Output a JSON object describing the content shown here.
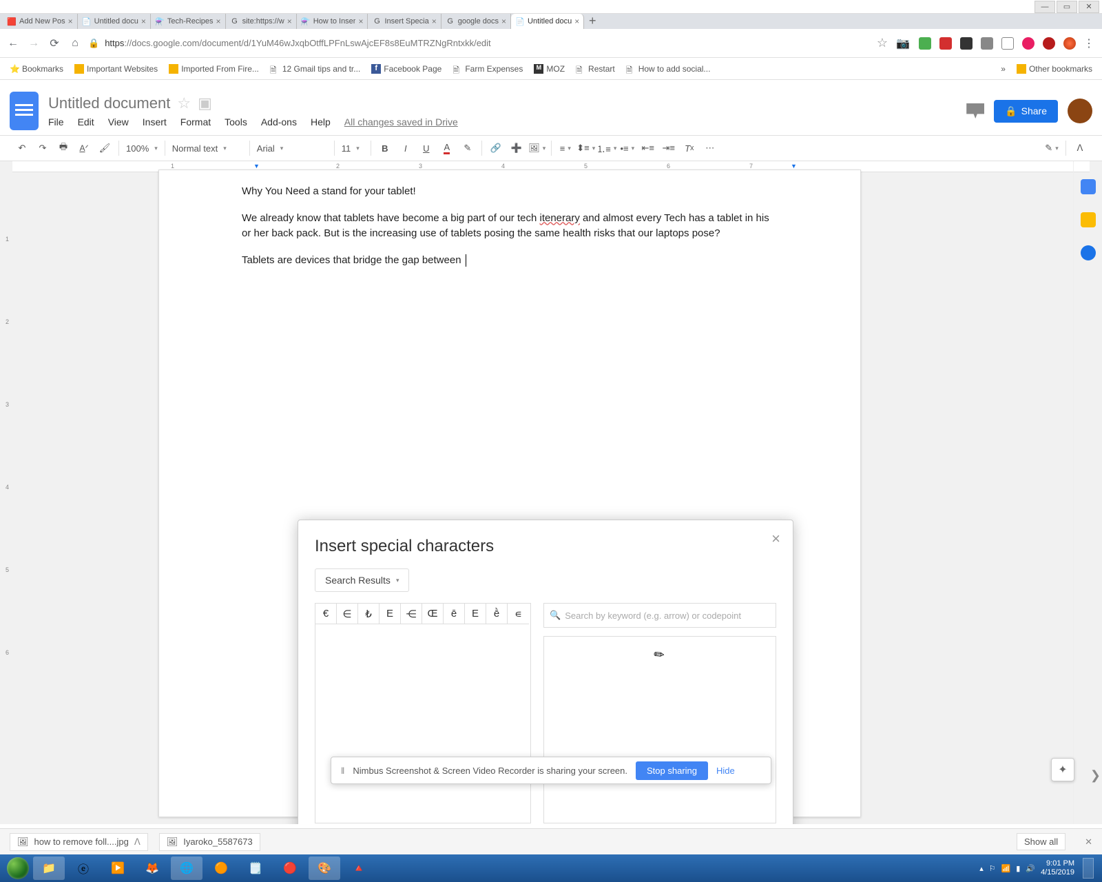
{
  "window_buttons": {
    "min": "—",
    "max": "▭",
    "close": "✕"
  },
  "tabs": [
    {
      "label": "Add New Pos",
      "icon": "🟥"
    },
    {
      "label": "Untitled docu",
      "icon": "📄"
    },
    {
      "label": "Tech-Recipes",
      "icon": "⚗️"
    },
    {
      "label": "site:https://w",
      "icon": "G"
    },
    {
      "label": "How to Inser",
      "icon": "⚗️"
    },
    {
      "label": "Insert Specia",
      "icon": "G"
    },
    {
      "label": "google docs",
      "icon": "G"
    },
    {
      "label": "Untitled docu",
      "icon": "📄",
      "active": true
    }
  ],
  "url": {
    "lock": "🔒",
    "secure": "https",
    "rest": "://docs.google.com/document/d/1YuM46wJxqbOtffLPFnLswAjcEF8s8EuMTRZNgRntxkk/edit"
  },
  "ext_colors": [
    "#f0b400",
    "#4caf50",
    "#d32f2f",
    "#333",
    "#555",
    "#795548",
    "#9c27b0",
    "#03a9f4",
    "#b71c1c"
  ],
  "bookmarks": [
    {
      "label": "Bookmarks",
      "ico": "⭐",
      "c": "#f5b301"
    },
    {
      "label": "Important Websites",
      "ico": "▣",
      "c": "#f5b301"
    },
    {
      "label": "Imported From Fire...",
      "ico": "▣",
      "c": "#f5b301"
    },
    {
      "label": "12 Gmail tips and tr...",
      "ico": "🗎",
      "c": "#888"
    },
    {
      "label": "Facebook Page",
      "ico": "f",
      "c": "#3b5998"
    },
    {
      "label": "Farm Expenses",
      "ico": "🗎",
      "c": "#888"
    },
    {
      "label": "MOZ",
      "ico": "M",
      "c": "#333"
    },
    {
      "label": "Restart",
      "ico": "🗎",
      "c": "#888"
    },
    {
      "label": "How to add social...",
      "ico": "🗎",
      "c": "#888"
    }
  ],
  "bookmarks_more": "»",
  "other_bookmarks": "Other bookmarks",
  "doc": {
    "title": "Untitled document",
    "menus": [
      "File",
      "Edit",
      "View",
      "Insert",
      "Format",
      "Tools",
      "Add-ons",
      "Help"
    ],
    "saved": "All changes saved in Drive"
  },
  "share": "Share",
  "toolbar": {
    "zoom": "100%",
    "style": "Normal text",
    "font": "Arial",
    "size": "11"
  },
  "ruler": [
    "1",
    "2",
    "3",
    "4",
    "5",
    "6",
    "7"
  ],
  "body": {
    "p1": "Why You Need a stand for your tablet!",
    "p2a": "We already know that tablets have become a big part of our tech ",
    "p2err": "itenerary",
    "p2b": " and almost every Tech has a tablet in his or her back pack. But is the increasing use of tablets posing the same health risks that our laptops pose?",
    "p3": "Tablets are devices that bridge the gap between "
  },
  "dialog": {
    "title": "Insert special characters",
    "mode": "Search Results",
    "chars": [
      "€",
      "∈",
      "₺",
      "Е",
      "⋲",
      "Œ",
      "ē",
      "Ε",
      "ḕ",
      "∊"
    ],
    "placeholder": "Search by keyword (e.g. arrow) or codepoint"
  },
  "sharebar": {
    "msg": "Nimbus Screenshot & Screen Video Recorder is sharing your screen.",
    "stop": "Stop sharing",
    "hide": "Hide"
  },
  "downloads": [
    {
      "name": "how to remove foll....jpg"
    },
    {
      "name": "Iyaroko_5587673"
    }
  ],
  "showall": "Show all",
  "tray": {
    "time": "9:01 PM",
    "date": "4/15/2019"
  },
  "side_colors": [
    "#4285f4",
    "#fbbc04",
    "#1a73e8"
  ]
}
